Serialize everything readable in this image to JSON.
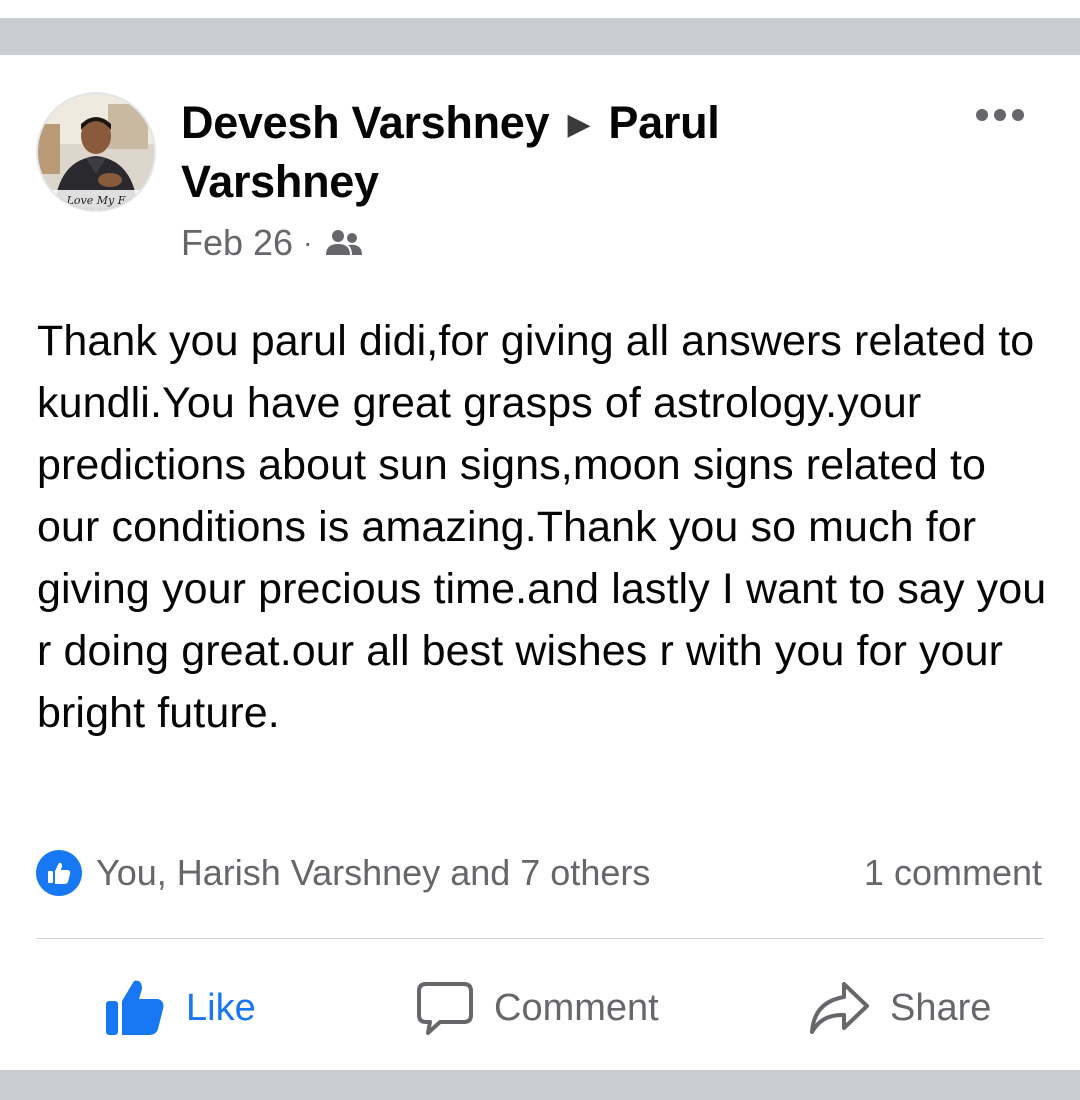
{
  "post": {
    "author": "Devesh Varshney",
    "recipient": "Parul Varshney",
    "arrow": "▶",
    "date": "Feb 26",
    "separator": "·",
    "audience_icon": "friends-icon",
    "avatar_caption": "Love My F",
    "more_icon": "more-options-icon",
    "text": "Thank you parul didi,for giving all answers related to kundli.You have great grasps of astrology.your predictions about sun signs,moon signs related to our conditions is amazing.Thank you so much for giving your precious time.and lastly I want to say you r doing great.our all best wishes r with you for your bright future."
  },
  "reactions": {
    "icon": "like-reaction-icon",
    "summary": "You, Harish Varshney and 7 others",
    "comments": "1 comment"
  },
  "actions": {
    "like_label": "Like",
    "comment_label": "Comment",
    "share_label": "Share"
  },
  "colors": {
    "accent": "#1877f2",
    "secondary_text": "#65676b",
    "band": "#c9ccd1"
  }
}
